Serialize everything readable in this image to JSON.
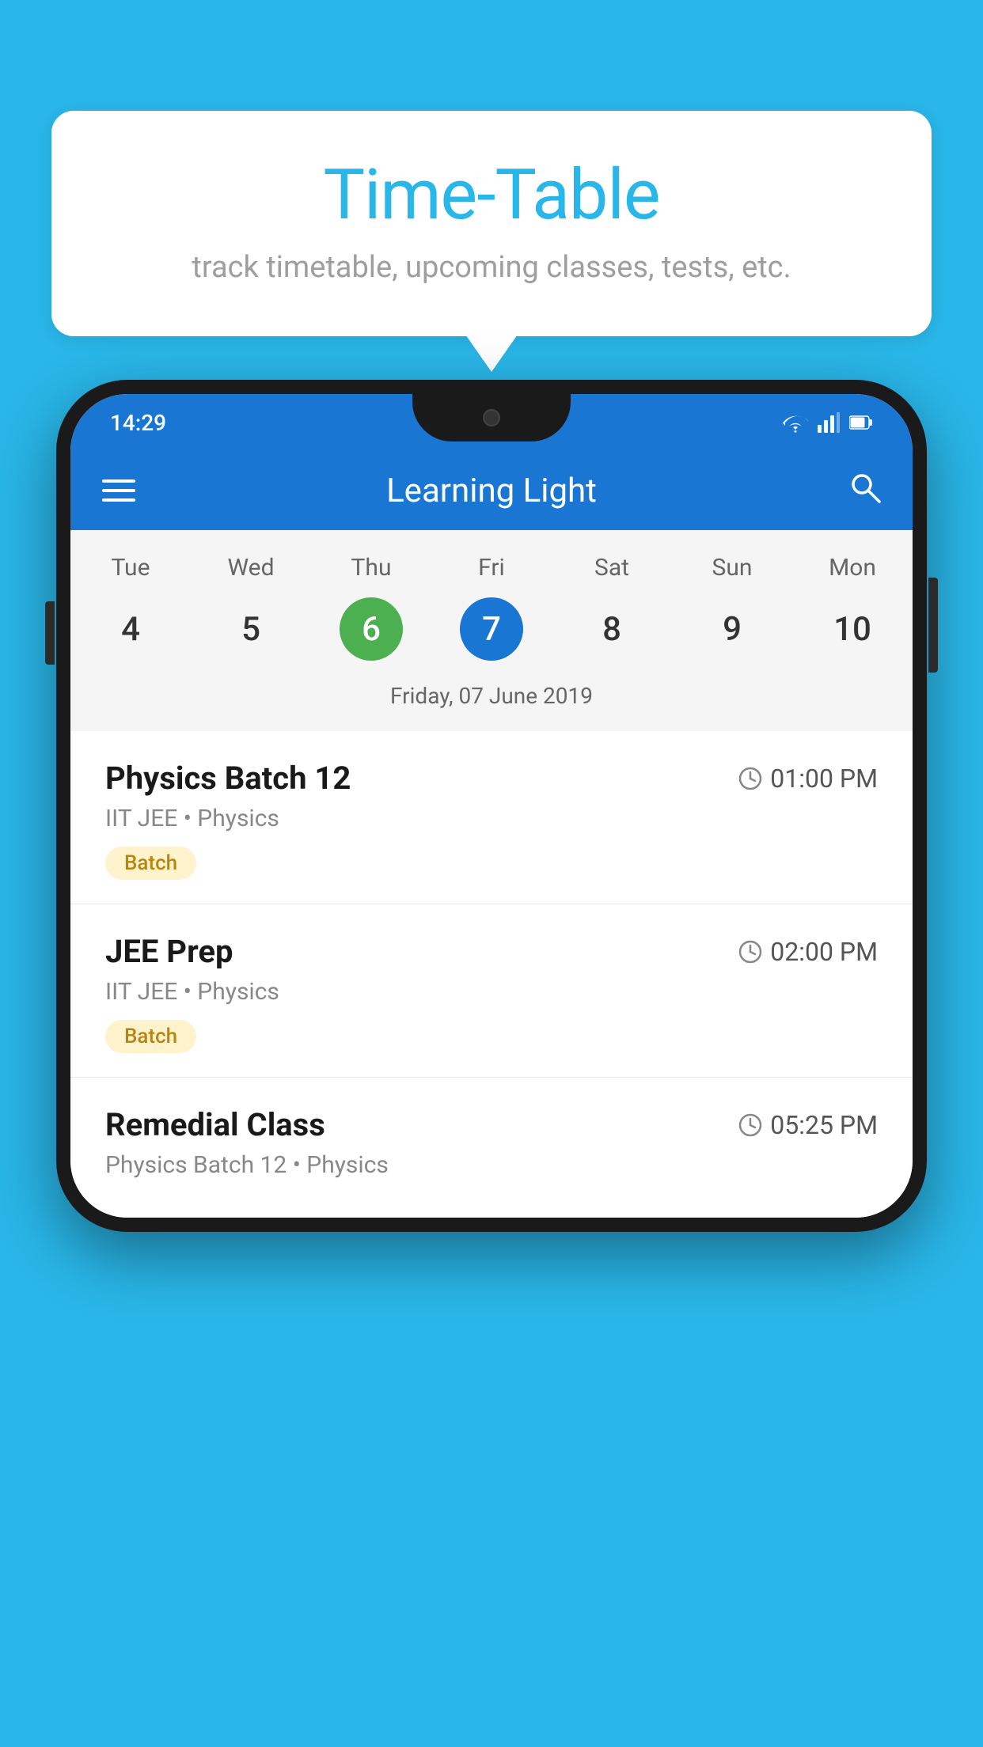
{
  "background_color": "#29B6E8",
  "speech_bubble": {
    "title": "Time-Table",
    "subtitle": "track timetable, upcoming classes, tests, etc."
  },
  "phone": {
    "status_bar": {
      "time": "14:29",
      "icons": [
        "wifi",
        "signal",
        "battery"
      ]
    },
    "app_bar": {
      "title": "Learning Light",
      "menu_icon": "hamburger",
      "search_icon": "search"
    },
    "calendar": {
      "days": [
        "Tue",
        "Wed",
        "Thu",
        "Fri",
        "Sat",
        "Sun",
        "Mon"
      ],
      "dates": [
        {
          "num": "4",
          "state": "normal"
        },
        {
          "num": "5",
          "state": "normal"
        },
        {
          "num": "6",
          "state": "today"
        },
        {
          "num": "7",
          "state": "selected"
        },
        {
          "num": "8",
          "state": "normal"
        },
        {
          "num": "9",
          "state": "normal"
        },
        {
          "num": "10",
          "state": "normal"
        }
      ],
      "selected_label": "Friday, 07 June 2019"
    },
    "schedule_items": [
      {
        "title": "Physics Batch 12",
        "time": "01:00 PM",
        "meta": "IIT JEE • Physics",
        "badge": "Batch"
      },
      {
        "title": "JEE Prep",
        "time": "02:00 PM",
        "meta": "IIT JEE • Physics",
        "badge": "Batch"
      },
      {
        "title": "Remedial Class",
        "time": "05:25 PM",
        "meta": "Physics Batch 12 • Physics",
        "badge": null
      }
    ]
  }
}
